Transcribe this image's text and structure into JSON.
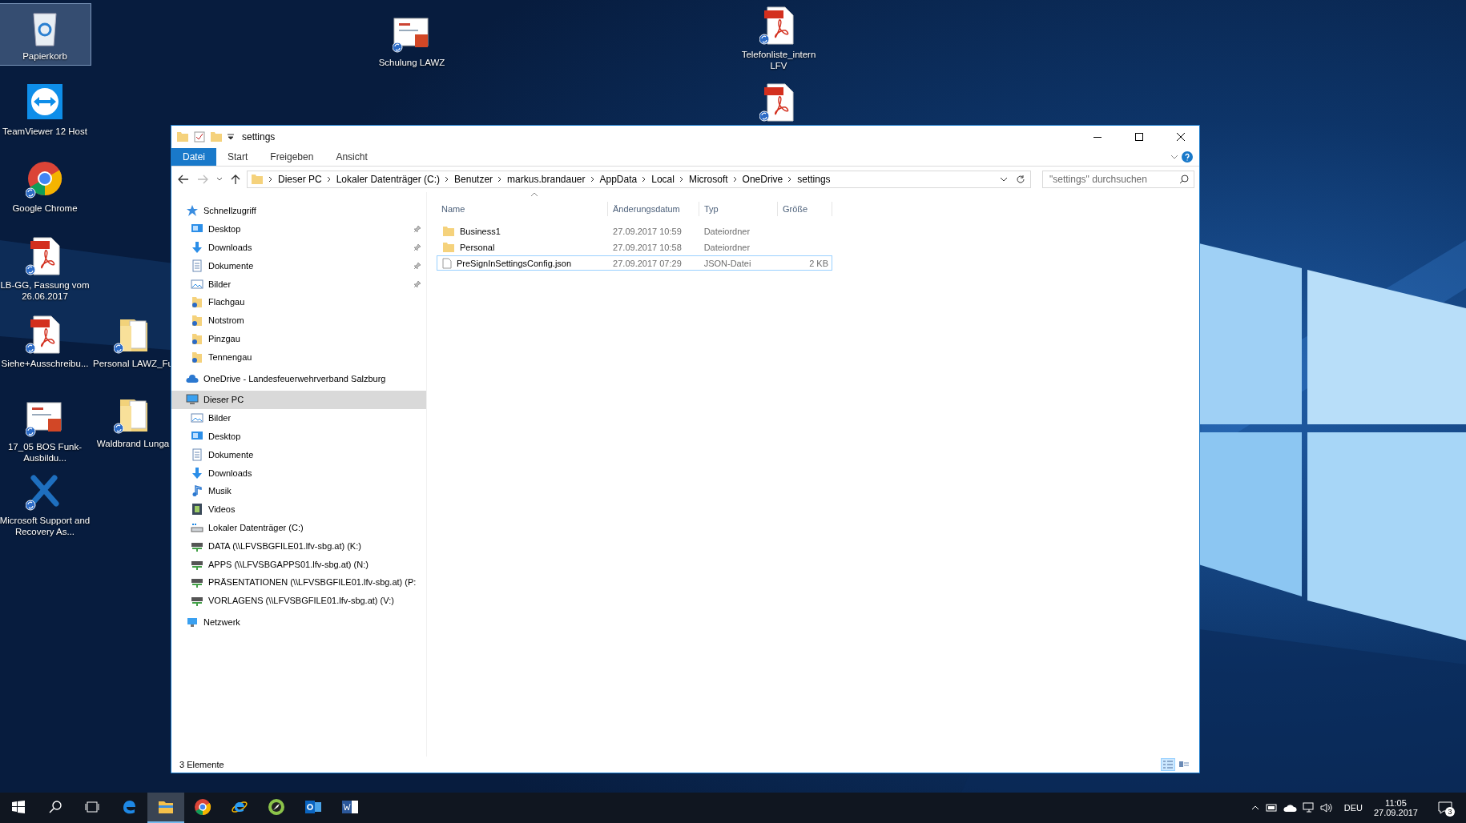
{
  "desktop_icons": [
    {
      "label": "Papierkorb",
      "kind": "recycle",
      "selected": true
    },
    {
      "label": "TeamViewer 12 Host",
      "kind": "teamviewer",
      "selected": false
    },
    {
      "label": "Google Chrome",
      "kind": "chrome",
      "selected": false
    },
    {
      "label": "LB-GG, Fassung vom 26.06.2017",
      "kind": "pdf",
      "selected": false
    },
    {
      "label": "Siehe+Ausschreibu...",
      "kind": "pdf",
      "selected": false
    },
    {
      "label": "Personal LAWZ_Fu",
      "kind": "folderdoc",
      "selected": false
    },
    {
      "label": "17_05 BOS Funk-Ausbildu...",
      "kind": "ppt",
      "selected": false
    },
    {
      "label": "Waldbrand Lunga",
      "kind": "folderdoc",
      "selected": false
    },
    {
      "label": "Microsoft Support and Recovery As...",
      "kind": "tools",
      "selected": false
    },
    {
      "label": "Schulung LAWZ",
      "kind": "ppt",
      "selected": false
    },
    {
      "label": "Telefonliste_intern LFV",
      "kind": "pdf",
      "selected": false
    },
    {
      "kind": "pdf",
      "selected": false
    }
  ],
  "explorer": {
    "title": "settings",
    "ribbon_tabs": [
      {
        "label": "Datei",
        "selected": true
      },
      {
        "label": "Start",
        "selected": false
      },
      {
        "label": "Freigeben",
        "selected": false
      },
      {
        "label": "Ansicht",
        "selected": false
      }
    ],
    "breadcrumbs": [
      "Dieser PC",
      "Lokaler Datenträger (C:)",
      "Benutzer",
      "markus.brandauer",
      "AppData",
      "Local",
      "Microsoft",
      "OneDrive",
      "settings"
    ],
    "search": {
      "placeholder": "\"settings\" durchsuchen"
    },
    "nav": [
      {
        "label": "Schnellzugriff",
        "selected": false,
        "children": [
          {
            "label": "Desktop",
            "pinned": true,
            "selected": false
          },
          {
            "label": "Downloads",
            "pinned": true,
            "selected": false
          },
          {
            "label": "Dokumente",
            "pinned": true,
            "selected": false
          },
          {
            "label": "Bilder",
            "pinned": true,
            "selected": false
          },
          {
            "label": "Flachgau",
            "pinned": false,
            "selected": false
          },
          {
            "label": "Notstrom",
            "pinned": false,
            "selected": false
          },
          {
            "label": "Pinzgau",
            "pinned": false,
            "selected": false
          },
          {
            "label": "Tennengau",
            "pinned": false,
            "selected": false
          }
        ]
      },
      {
        "label": "OneDrive - Landesfeuerwehrverband Salzburg",
        "selected": false
      },
      {
        "label": "Dieser PC",
        "selected": true,
        "children": [
          {
            "label": "Bilder",
            "pinned": false,
            "selected": false
          },
          {
            "label": "Desktop",
            "pinned": false,
            "selected": false
          },
          {
            "label": "Dokumente",
            "pinned": false,
            "selected": false
          },
          {
            "label": "Downloads",
            "pinned": false,
            "selected": false
          },
          {
            "label": "Musik",
            "pinned": false,
            "selected": false
          },
          {
            "label": "Videos",
            "pinned": false,
            "selected": false
          },
          {
            "label": "Lokaler Datenträger (C:)",
            "pinned": false,
            "selected": false
          },
          {
            "label": "DATA (\\\\LFVSBGFILE01.lfv-sbg.at) (K:)",
            "pinned": false,
            "selected": false
          },
          {
            "label": "APPS (\\\\LFVSBGAPPS01.lfv-sbg.at) (N:)",
            "pinned": false,
            "selected": false
          },
          {
            "label": "PRÄSENTATIONEN (\\\\LFVSBGFILE01.lfv-sbg.at) (P:",
            "pinned": false,
            "selected": false
          },
          {
            "label": "VORLAGENS (\\\\LFVSBGFILE01.lfv-sbg.at) (V:)",
            "pinned": false,
            "selected": false
          }
        ]
      },
      {
        "label": "Netzwerk",
        "selected": false
      }
    ],
    "columns": [
      {
        "label": "Name",
        "sorted": true
      },
      {
        "label": "Änderungsdatum",
        "sorted": false
      },
      {
        "label": "Typ",
        "sorted": false
      },
      {
        "label": "Größe",
        "sorted": false
      }
    ],
    "rows": [
      {
        "name": "Business1",
        "date": "27.09.2017 10:59",
        "type": "Dateiordner",
        "kind": "folder",
        "focused": false
      },
      {
        "name": "Personal",
        "date": "27.09.2017 10:58",
        "type": "Dateiordner",
        "kind": "folder",
        "focused": false
      },
      {
        "name": "PreSignInSettingsConfig.json",
        "date": "27.09.2017 07:29",
        "type": "JSON-Datei",
        "size": "2 KB",
        "kind": "file",
        "focused": true
      }
    ],
    "status": "3 Elemente",
    "views": [
      {
        "kind": "details",
        "selected": true
      },
      {
        "kind": "tiles",
        "selected": false
      }
    ]
  },
  "taskbar": {
    "apps": [
      {
        "kind": "edge",
        "active": false
      },
      {
        "kind": "explorer",
        "active": true
      },
      {
        "kind": "chrome",
        "active": false
      },
      {
        "kind": "ie",
        "active": false
      },
      {
        "kind": "green",
        "active": false
      },
      {
        "kind": "outlook",
        "active": false
      },
      {
        "kind": "word",
        "active": false
      }
    ],
    "language": "DEU",
    "time": "11:05",
    "date": "27.09.2017",
    "notifications": "3"
  }
}
